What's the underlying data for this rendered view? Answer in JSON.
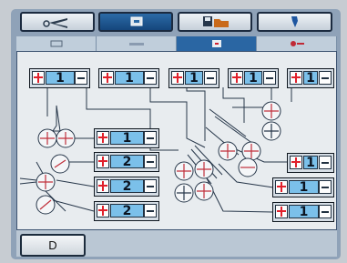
{
  "top_buttons": [
    {
      "icon": "scissors-icon",
      "state": "light"
    },
    {
      "icon": "display-icon",
      "state": "dark"
    },
    {
      "icon": "folder-save-icon",
      "state": "light"
    },
    {
      "icon": "needle-icon",
      "state": "light"
    }
  ],
  "tabs": [
    {
      "icon": "tab-icon-1",
      "active": false
    },
    {
      "icon": "tab-icon-2",
      "active": false
    },
    {
      "icon": "tab-icon-3",
      "active": true
    },
    {
      "icon": "tab-icon-4",
      "active": false
    }
  ],
  "steppers": {
    "top": [
      "1",
      "1",
      "1",
      "1",
      "1"
    ],
    "left": [
      "1",
      "2",
      "2",
      "2"
    ],
    "right": [
      "1",
      "1",
      "1"
    ]
  },
  "bottom": {
    "mode_label": "D"
  },
  "colors": {
    "accent": "#2a66a3",
    "value_fill": "#7bc0ea",
    "plus_red": "#e0202b",
    "frame": "#8fa2b8"
  }
}
